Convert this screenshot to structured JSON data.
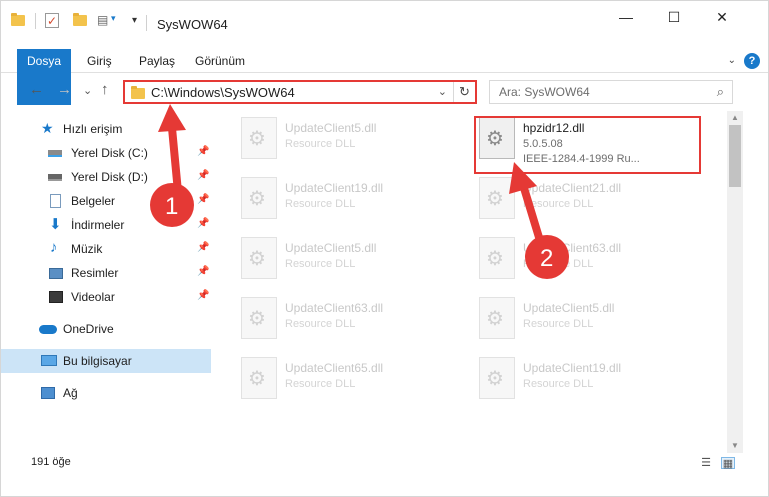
{
  "window": {
    "title": "SysWOW64",
    "minimize_glyph": "—",
    "maximize_glyph": "☐",
    "close_glyph": "✕"
  },
  "ribbon": {
    "tabs": [
      "Dosya",
      "Giriş",
      "Paylaş",
      "Görünüm"
    ],
    "expand_glyph": "⌄",
    "help_glyph": "?"
  },
  "nav": {
    "back_glyph": "←",
    "forward_glyph": "→",
    "recent_glyph": "⌄",
    "up_glyph": "↑",
    "address_path": "C:\\Windows\\SysWOW64",
    "dropdown_glyph": "⌄",
    "refresh_glyph": "↻",
    "search_placeholder": "Ara: SysWOW64",
    "search_glyph": "⌕"
  },
  "sidebar": {
    "quick_access": "Hızlı erişim",
    "items": [
      {
        "label": "Yerel Disk (C:)",
        "icon": "drive-icon",
        "pinned": true
      },
      {
        "label": "Yerel Disk (D:)",
        "icon": "drive-icon",
        "pinned": true
      },
      {
        "label": "Belgeler",
        "icon": "documents-icon",
        "pinned": true
      },
      {
        "label": "İndirmeler",
        "icon": "downloads-icon",
        "pinned": true
      },
      {
        "label": "Müzik",
        "icon": "music-icon",
        "pinned": true
      },
      {
        "label": "Resimler",
        "icon": "pictures-icon",
        "pinned": true
      },
      {
        "label": "Videolar",
        "icon": "videos-icon",
        "pinned": true
      }
    ],
    "onedrive": "OneDrive",
    "this_pc": "Bu bilgisayar",
    "network": "Ağ",
    "pin_glyph": "📌"
  },
  "files": {
    "left_column": [
      {
        "name": "UpdateClient5.dll",
        "desc": "Resource DLL"
      },
      {
        "name": "UpdateClient19.dll",
        "desc": "Resource DLL"
      },
      {
        "name": "UpdateClient5.dll",
        "desc": "Resource DLL"
      },
      {
        "name": "UpdateClient63.dll",
        "desc": "Resource DLL"
      },
      {
        "name": "UpdateClient65.dll",
        "desc": "Resource DLL"
      }
    ],
    "right_column": [
      {
        "name": "hpzidr12.dll",
        "version": "5.0.5.08",
        "lang": "IEEE-1284.4-1999 Ru..."
      },
      {
        "name": "UpdateClient21.dll",
        "desc": "Resource DLL"
      },
      {
        "name": "UpdateClient63.dll",
        "desc": "Resource DLL"
      },
      {
        "name": "UpdateClient5.dll",
        "desc": "Resource DLL"
      },
      {
        "name": "UpdateClient19.dll",
        "desc": "Resource DLL"
      }
    ]
  },
  "status": {
    "item_count": "191 öğe"
  },
  "annotations": {
    "step1": "1",
    "step2": "2",
    "color": "#e53935"
  },
  "colors": {
    "accent": "#1979ca",
    "selection": "#cce4f7",
    "highlight": "#e53935"
  }
}
